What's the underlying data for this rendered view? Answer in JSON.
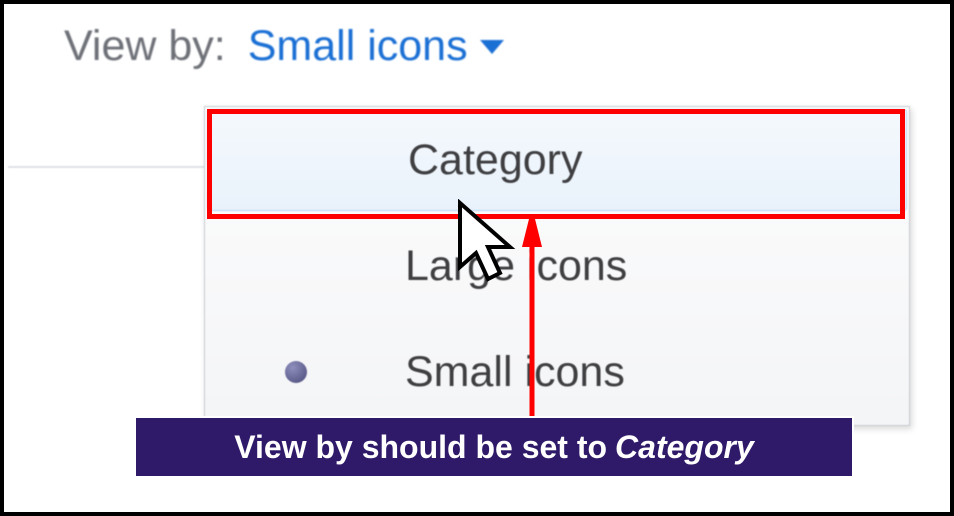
{
  "header": {
    "label": "View by:",
    "current_value": "Small icons"
  },
  "dropdown": {
    "items": [
      {
        "label": "Category",
        "selected": false,
        "hovered": true
      },
      {
        "label": "Large icons",
        "selected": false,
        "hovered": false
      },
      {
        "label": "Small icons",
        "selected": true,
        "hovered": false
      }
    ]
  },
  "annotation": {
    "caption_prefix": "View by should be set to",
    "caption_emphasis": "Category"
  },
  "colors": {
    "highlight": "#ff0000",
    "arrow": "#ff0000",
    "caption_bg": "#2f1a6a",
    "link": "#1a6fd4"
  }
}
